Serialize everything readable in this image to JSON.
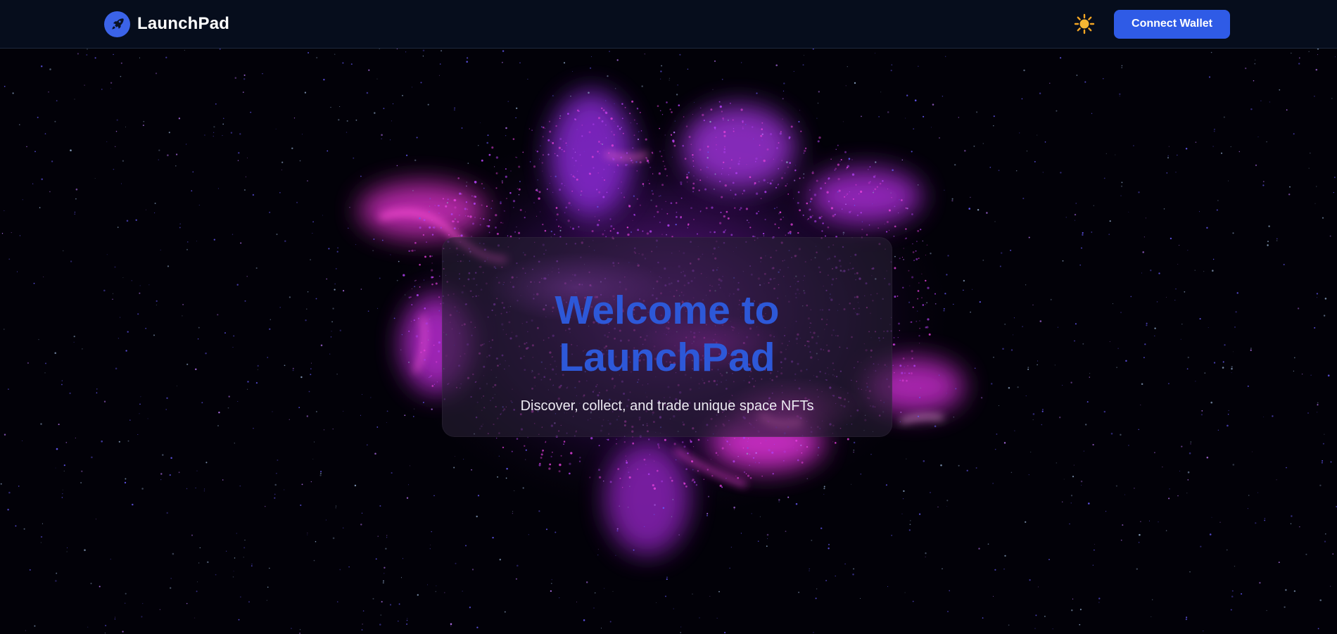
{
  "app": {
    "brand_name": "LaunchPad",
    "logo_icon": "rocket-icon"
  },
  "header": {
    "theme_toggle_icon": "sun-icon",
    "theme_toggle_glyph": "☀️",
    "connect_wallet_label": "Connect Wallet"
  },
  "hero": {
    "title": "Welcome to LaunchPad",
    "subtitle": "Discover, collect, and trade unique space NFTs"
  },
  "colors": {
    "nav_background": "#060d1c",
    "accent": "#2f5be6",
    "title_blue": "#2d58d8",
    "nebula_magenta": "#e030e0",
    "nebula_purple": "#7a2bd6"
  }
}
